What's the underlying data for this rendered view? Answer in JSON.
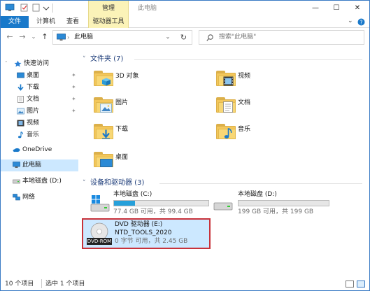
{
  "window": {
    "title": "此电脑",
    "manage_tab": "管理",
    "minimize": "—",
    "maximize": "☐",
    "close": "✕"
  },
  "ribbon": {
    "tabs": [
      {
        "label": "文件"
      },
      {
        "label": "计算机"
      },
      {
        "label": "查看"
      },
      {
        "label": "驱动器工具"
      }
    ]
  },
  "address_bar": {
    "path": "此电脑",
    "search_placeholder": "搜索\"此电脑\""
  },
  "sidebar": {
    "items": [
      {
        "label": "快速访问"
      },
      {
        "label": "桌面"
      },
      {
        "label": "下载"
      },
      {
        "label": "文档"
      },
      {
        "label": "图片"
      },
      {
        "label": "视频"
      },
      {
        "label": "音乐"
      },
      {
        "label": "OneDrive"
      },
      {
        "label": "此电脑"
      },
      {
        "label": "本地磁盘 (D:)"
      },
      {
        "label": "网络"
      }
    ]
  },
  "folders_group": {
    "header": "文件夹 (7)",
    "items": [
      {
        "label": "3D 对象"
      },
      {
        "label": "视频"
      },
      {
        "label": "图片"
      },
      {
        "label": "文档"
      },
      {
        "label": "下载"
      },
      {
        "label": "音乐"
      },
      {
        "label": "桌面"
      }
    ]
  },
  "drives_group": {
    "header": "设备和驱动器 (3)",
    "drives": [
      {
        "name": "本地磁盘 (C:)",
        "space": "77.4 GB 可用，共 99.4 GB",
        "used_fraction": 0.22
      },
      {
        "name": "本地磁盘 (D:)",
        "space": "199 GB 可用，共 199 GB",
        "used_fraction": 0.0
      },
      {
        "name": "DVD 驱动器 (E:)",
        "volume": "NTD_TOOLS_2020",
        "space": "0 字节 可用，共 2.45 GB",
        "badge": "DVD-ROM"
      }
    ]
  },
  "status_bar": {
    "count": "10 个项目",
    "selection": "选中 1 个项目"
  },
  "colors": {
    "accent": "#1979ca",
    "selection": "#cce8ff",
    "highlight_border": "#c8323a",
    "drive_bar": "#26a0da"
  }
}
